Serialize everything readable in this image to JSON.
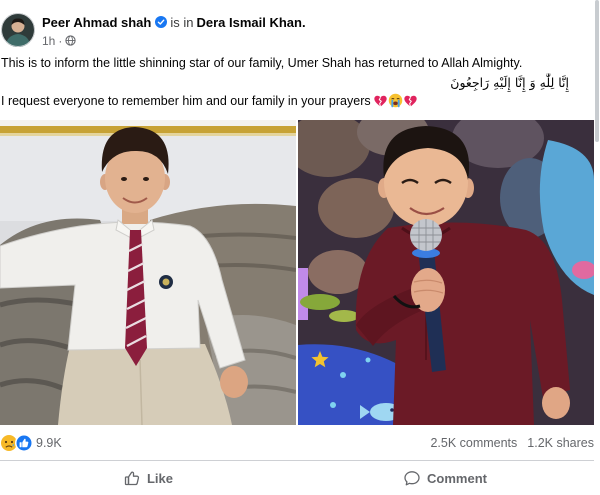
{
  "header": {
    "author_name": "Peer Ahmad shah",
    "connector": "is in",
    "location": "Dera Ismail Khan.",
    "timestamp": "1h",
    "separator": "·",
    "icons": {
      "verified": "verified-badge-icon",
      "privacy": "globe-icon"
    }
  },
  "body": {
    "line_1": "This is to inform the little shinning star of our family, Umer Shah has returned to Allah Almighty.",
    "arabic_line": "إِنَّا لِلَّٰهِ وَ إِنَّا إِلَيْهِ رَاجِعُونَ",
    "line_3": "I request everyone to remember him and our family in your prayers",
    "line_3_emoji_icons": [
      "broken-heart-icon",
      "loudly-crying-face-icon",
      "broken-heart-icon"
    ]
  },
  "engagement": {
    "reaction_icons": [
      "sad-reaction-icon",
      "like-reaction-icon"
    ],
    "reaction_count": "9.9K",
    "comments": "2.5K comments",
    "shares": "1.2K shares"
  },
  "actions": {
    "like_label": "Like",
    "comment_label": "Comment",
    "icons": [
      "like-icon",
      "comment-icon"
    ]
  },
  "colors": {
    "accent": "#1877f2",
    "primary_text": "#050505",
    "secondary_text": "#65676b",
    "divider": "#ced0d4"
  }
}
